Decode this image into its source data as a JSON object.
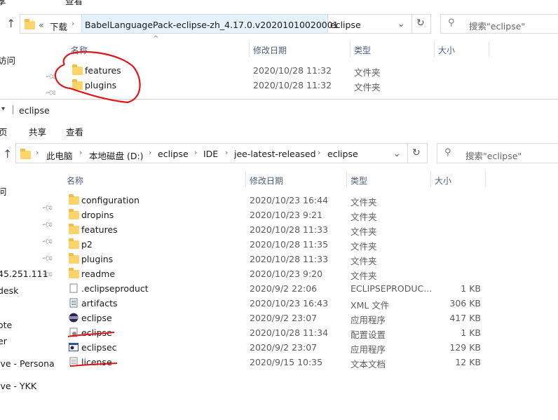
{
  "top_window": {
    "ribbon_partial": [
      "享",
      "查看"
    ],
    "address": {
      "overflow": "«",
      "crumbs": [
        "下载",
        "BabelLanguagePack-eclipse-zh_4.17.0.v20201010020001",
        "eclipse"
      ]
    },
    "search_placeholder": "搜索\"eclipse\"",
    "columns": {
      "name": "名称",
      "date": "修改日期",
      "type": "类型",
      "size": "大小"
    },
    "nav_partial": [
      "访问"
    ],
    "files": [
      {
        "name": "features",
        "date": "2020/10/28 11:32",
        "type": "文件夹",
        "size": ""
      },
      {
        "name": "plugins",
        "date": "2020/10/28 11:32",
        "type": "文件夹",
        "size": ""
      }
    ]
  },
  "bottom_window": {
    "title": "eclipse",
    "ribbon": {
      "file": "页",
      "share": "共享",
      "view": "查看"
    },
    "address": {
      "crumbs": [
        "此电脑",
        "本地磁盘 (D:)",
        "eclipse",
        "IDE",
        "jee-latest-released",
        "eclipse"
      ]
    },
    "search_placeholder": "搜索\"eclipse\"",
    "columns": {
      "name": "名称",
      "date": "修改日期",
      "type": "类型",
      "size": "大小"
    },
    "nav_partial": [
      "问",
      "45.251.111",
      "desk",
      "ote",
      "er",
      "ive - Persona",
      "ive - YKK"
    ],
    "files": [
      {
        "name": "configuration",
        "date": "2020/10/23 16:44",
        "type": "文件夹",
        "size": "",
        "icon": "folder-icon"
      },
      {
        "name": "dropins",
        "date": "2020/10/23 9:21",
        "type": "文件夹",
        "size": "",
        "icon": "folder-icon"
      },
      {
        "name": "features",
        "date": "2020/10/28 11:33",
        "type": "文件夹",
        "size": "",
        "icon": "folder-icon"
      },
      {
        "name": "p2",
        "date": "2020/10/28 11:35",
        "type": "文件夹",
        "size": "",
        "icon": "folder-icon"
      },
      {
        "name": "plugins",
        "date": "2020/10/28 11:33",
        "type": "文件夹",
        "size": "",
        "icon": "folder-icon"
      },
      {
        "name": "readme",
        "date": "2020/10/23 9:20",
        "type": "文件夹",
        "size": "",
        "icon": "folder-icon"
      },
      {
        "name": ".eclipseproduct",
        "date": "2020/9/2 22:06",
        "type": "ECLIPSEPRODUC...",
        "size": "1 KB",
        "icon": "file-icon"
      },
      {
        "name": "artifacts",
        "date": "2020/10/23 16:43",
        "type": "XML 文件",
        "size": "306 KB",
        "icon": "xml-file-icon"
      },
      {
        "name": "eclipse",
        "date": "2020/9/2 23:07",
        "type": "应用程序",
        "size": "417 KB",
        "icon": "eclipse-app-icon"
      },
      {
        "name": "eclipse",
        "date": "2020/10/28 11:34",
        "type": "配置设置",
        "size": "1 KB",
        "icon": "config-file-icon"
      },
      {
        "name": "eclipsec",
        "date": "2020/9/2 23:07",
        "type": "应用程序",
        "size": "129 KB",
        "icon": "console-app-icon"
      },
      {
        "name": "license",
        "date": "2020/9/15 10:35",
        "type": "文本文档",
        "size": "12 KB",
        "icon": "text-file-icon"
      }
    ]
  },
  "annotation_color": "#e0151b"
}
